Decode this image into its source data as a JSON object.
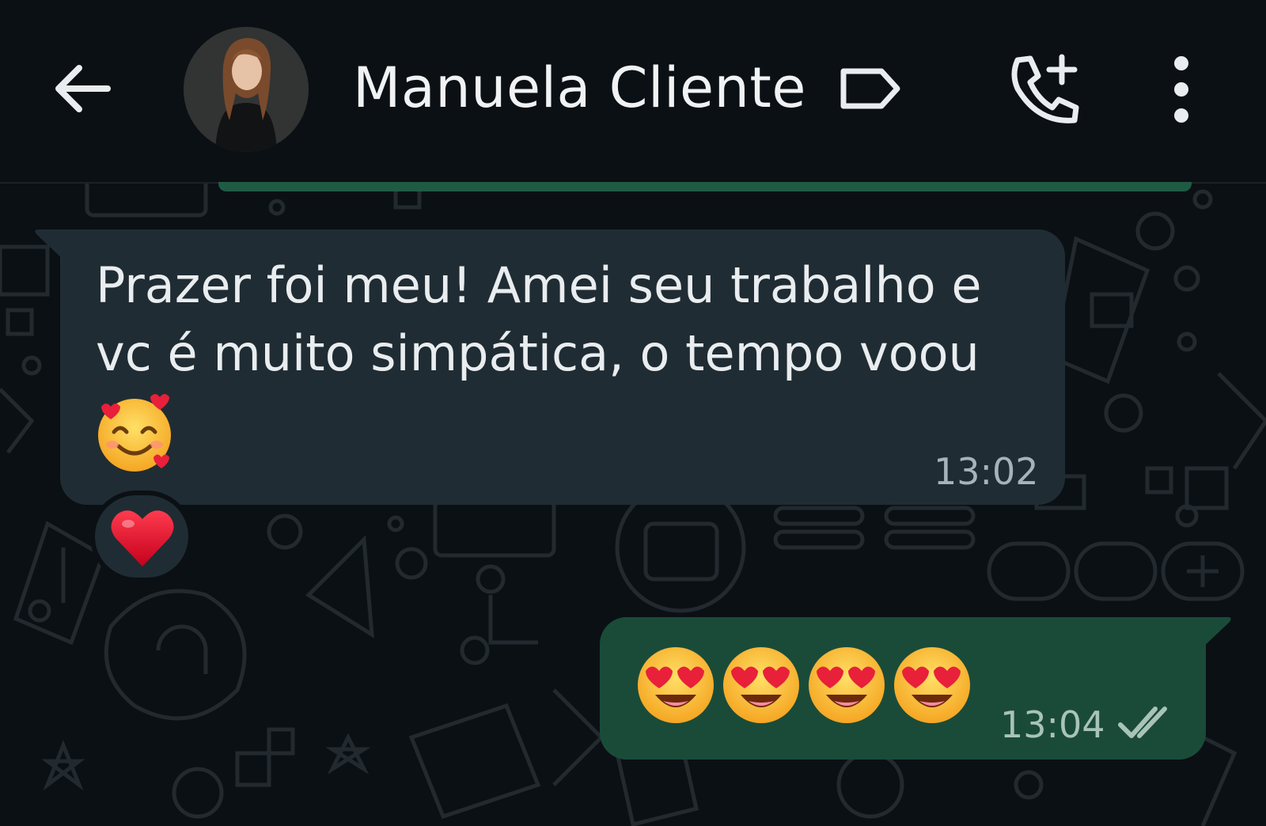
{
  "header": {
    "contact_name": "Manuela Cliente",
    "icons": [
      "back-arrow-icon",
      "label-icon",
      "add-call-icon",
      "more-options-icon"
    ]
  },
  "messages": [
    {
      "direction": "incoming",
      "text": "Prazer foi meu! Amei seu trabalho e\nvc é muito simpática, o tempo voou",
      "trailing_emoji": "smiling-face-with-hearts",
      "time": "13:02",
      "reaction": "red-heart"
    },
    {
      "direction": "outgoing",
      "emojis": [
        "heart-eyes",
        "heart-eyes",
        "heart-eyes",
        "heart-eyes"
      ],
      "time": "13:04",
      "status": "read"
    }
  ],
  "colors": {
    "background": "#0b1014",
    "incoming_bubble": "#202c33",
    "outgoing_bubble": "#1a4b39",
    "text": "#e9edef"
  }
}
